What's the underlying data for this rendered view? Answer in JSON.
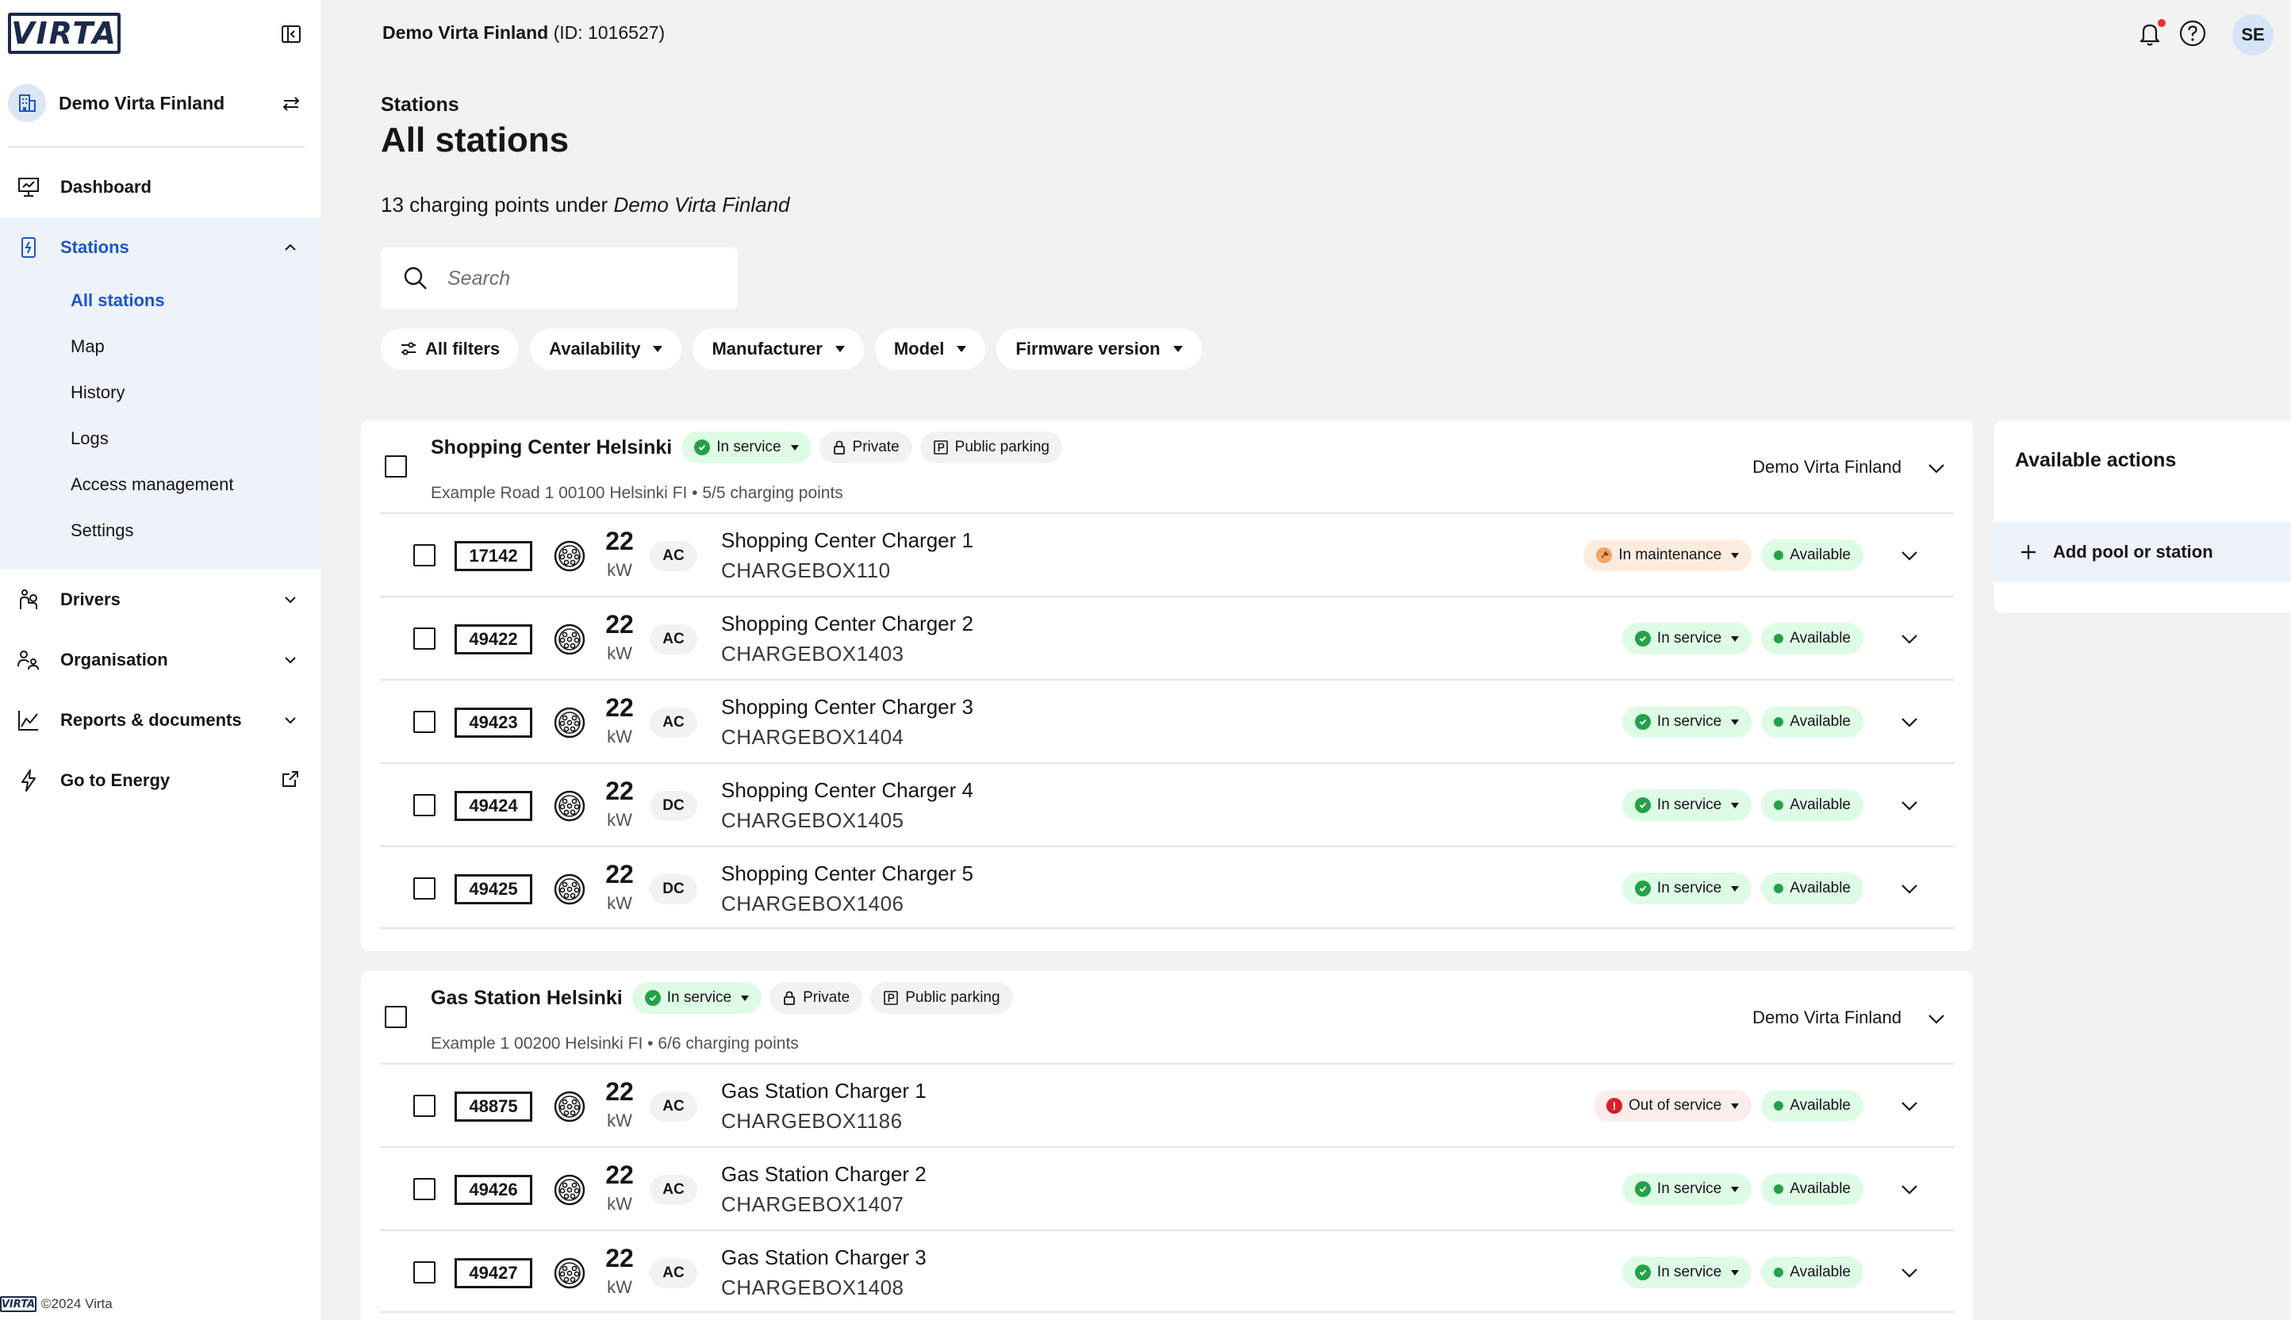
{
  "brand": {
    "logo_text": "VIRTA",
    "copyright": "©2024 Virta"
  },
  "sidebar": {
    "org_name": "Demo Virta Finland",
    "nav": [
      {
        "label": "Dashboard"
      },
      {
        "label": "Stations"
      },
      {
        "label": "Drivers"
      },
      {
        "label": "Organisation"
      },
      {
        "label": "Reports & documents"
      },
      {
        "label": "Go to Energy"
      }
    ],
    "stations_sub": [
      "All stations",
      "Map",
      "History",
      "Logs",
      "Access management",
      "Settings"
    ]
  },
  "topbar": {
    "account_name": "Demo Virta Finland",
    "account_id": "(ID: 1016527)",
    "user_initials": "SE"
  },
  "page": {
    "breadcrumb": "Stations",
    "title": "All stations",
    "subtitle_prefix": "13 charging points under",
    "subtitle_org": "Demo Virta Finland"
  },
  "search": {
    "placeholder": "Search"
  },
  "filters": {
    "all": "All filters",
    "availability": "Availability",
    "manufacturer": "Manufacturer",
    "model": "Model",
    "firmware": "Firmware version"
  },
  "pools": [
    {
      "name": "Shopping Center Helsinki",
      "status": "In service",
      "access": "Private",
      "parking": "Public parking",
      "address": "Example Road 1 00100 Helsinki FI • 5/5 charging points",
      "org": "Demo Virta Finland",
      "points": [
        {
          "id": "17142",
          "power": "22",
          "unit": "kW",
          "current": "AC",
          "name": "Shopping Center Charger 1",
          "box": "CHARGEBOX110",
          "status": "In maintenance",
          "availability": "Available"
        },
        {
          "id": "49422",
          "power": "22",
          "unit": "kW",
          "current": "AC",
          "name": "Shopping Center Charger 2",
          "box": "CHARGEBOX1403",
          "status": "In service",
          "availability": "Available"
        },
        {
          "id": "49423",
          "power": "22",
          "unit": "kW",
          "current": "AC",
          "name": "Shopping Center Charger 3",
          "box": "CHARGEBOX1404",
          "status": "In service",
          "availability": "Available"
        },
        {
          "id": "49424",
          "power": "22",
          "unit": "kW",
          "current": "DC",
          "name": "Shopping Center Charger 4",
          "box": "CHARGEBOX1405",
          "status": "In service",
          "availability": "Available"
        },
        {
          "id": "49425",
          "power": "22",
          "unit": "kW",
          "current": "DC",
          "name": "Shopping Center Charger 5",
          "box": "CHARGEBOX1406",
          "status": "In service",
          "availability": "Available"
        }
      ]
    },
    {
      "name": "Gas Station Helsinki",
      "status": "In service",
      "access": "Private",
      "parking": "Public parking",
      "address": "Example 1 00200 Helsinki FI • 6/6 charging points",
      "org": "Demo Virta Finland",
      "points": [
        {
          "id": "48875",
          "power": "22",
          "unit": "kW",
          "current": "AC",
          "name": "Gas Station Charger 1",
          "box": "CHARGEBOX1186",
          "status": "Out of service",
          "availability": "Available"
        },
        {
          "id": "49426",
          "power": "22",
          "unit": "kW",
          "current": "AC",
          "name": "Gas Station Charger 2",
          "box": "CHARGEBOX1407",
          "status": "In service",
          "availability": "Available"
        },
        {
          "id": "49427",
          "power": "22",
          "unit": "kW",
          "current": "AC",
          "name": "Gas Station Charger 3",
          "box": "CHARGEBOX1408",
          "status": "In service",
          "availability": "Available"
        }
      ]
    }
  ],
  "actions": {
    "title": "Available actions",
    "add_label": "Add pool or station"
  },
  "colors": {
    "accent": "#1a56c7",
    "success": "#24a148",
    "warning": "#f1a56a",
    "danger": "#da1e28"
  }
}
